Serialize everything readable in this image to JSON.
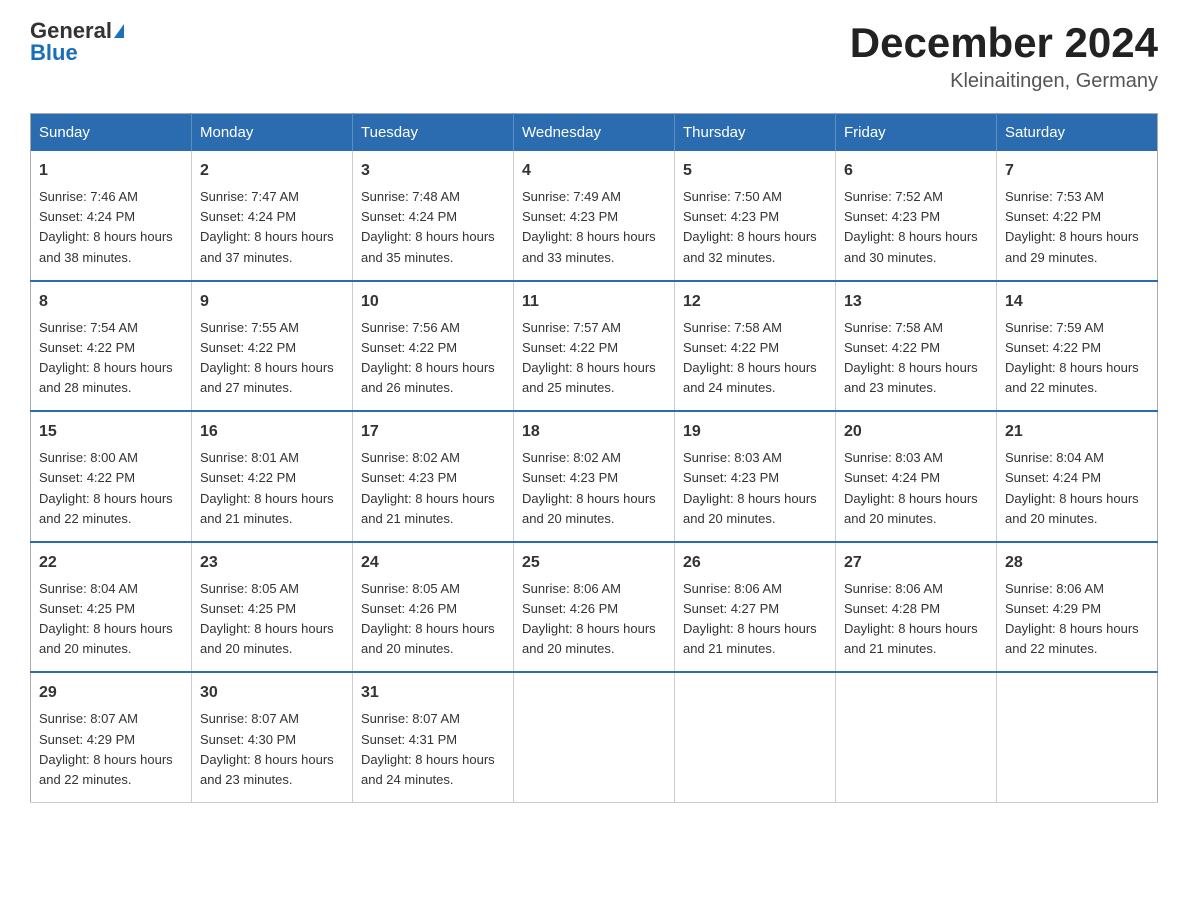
{
  "header": {
    "logo_general": "General",
    "logo_blue": "Blue",
    "month_title": "December 2024",
    "location": "Kleinaitingen, Germany"
  },
  "days_of_week": [
    "Sunday",
    "Monday",
    "Tuesday",
    "Wednesday",
    "Thursday",
    "Friday",
    "Saturday"
  ],
  "weeks": [
    [
      {
        "day": "1",
        "sunrise": "7:46 AM",
        "sunset": "4:24 PM",
        "daylight": "8 hours and 38 minutes."
      },
      {
        "day": "2",
        "sunrise": "7:47 AM",
        "sunset": "4:24 PM",
        "daylight": "8 hours and 37 minutes."
      },
      {
        "day": "3",
        "sunrise": "7:48 AM",
        "sunset": "4:24 PM",
        "daylight": "8 hours and 35 minutes."
      },
      {
        "day": "4",
        "sunrise": "7:49 AM",
        "sunset": "4:23 PM",
        "daylight": "8 hours and 33 minutes."
      },
      {
        "day": "5",
        "sunrise": "7:50 AM",
        "sunset": "4:23 PM",
        "daylight": "8 hours and 32 minutes."
      },
      {
        "day": "6",
        "sunrise": "7:52 AM",
        "sunset": "4:23 PM",
        "daylight": "8 hours and 30 minutes."
      },
      {
        "day": "7",
        "sunrise": "7:53 AM",
        "sunset": "4:22 PM",
        "daylight": "8 hours and 29 minutes."
      }
    ],
    [
      {
        "day": "8",
        "sunrise": "7:54 AM",
        "sunset": "4:22 PM",
        "daylight": "8 hours and 28 minutes."
      },
      {
        "day": "9",
        "sunrise": "7:55 AM",
        "sunset": "4:22 PM",
        "daylight": "8 hours and 27 minutes."
      },
      {
        "day": "10",
        "sunrise": "7:56 AM",
        "sunset": "4:22 PM",
        "daylight": "8 hours and 26 minutes."
      },
      {
        "day": "11",
        "sunrise": "7:57 AM",
        "sunset": "4:22 PM",
        "daylight": "8 hours and 25 minutes."
      },
      {
        "day": "12",
        "sunrise": "7:58 AM",
        "sunset": "4:22 PM",
        "daylight": "8 hours and 24 minutes."
      },
      {
        "day": "13",
        "sunrise": "7:58 AM",
        "sunset": "4:22 PM",
        "daylight": "8 hours and 23 minutes."
      },
      {
        "day": "14",
        "sunrise": "7:59 AM",
        "sunset": "4:22 PM",
        "daylight": "8 hours and 22 minutes."
      }
    ],
    [
      {
        "day": "15",
        "sunrise": "8:00 AM",
        "sunset": "4:22 PM",
        "daylight": "8 hours and 22 minutes."
      },
      {
        "day": "16",
        "sunrise": "8:01 AM",
        "sunset": "4:22 PM",
        "daylight": "8 hours and 21 minutes."
      },
      {
        "day": "17",
        "sunrise": "8:02 AM",
        "sunset": "4:23 PM",
        "daylight": "8 hours and 21 minutes."
      },
      {
        "day": "18",
        "sunrise": "8:02 AM",
        "sunset": "4:23 PM",
        "daylight": "8 hours and 20 minutes."
      },
      {
        "day": "19",
        "sunrise": "8:03 AM",
        "sunset": "4:23 PM",
        "daylight": "8 hours and 20 minutes."
      },
      {
        "day": "20",
        "sunrise": "8:03 AM",
        "sunset": "4:24 PM",
        "daylight": "8 hours and 20 minutes."
      },
      {
        "day": "21",
        "sunrise": "8:04 AM",
        "sunset": "4:24 PM",
        "daylight": "8 hours and 20 minutes."
      }
    ],
    [
      {
        "day": "22",
        "sunrise": "8:04 AM",
        "sunset": "4:25 PM",
        "daylight": "8 hours and 20 minutes."
      },
      {
        "day": "23",
        "sunrise": "8:05 AM",
        "sunset": "4:25 PM",
        "daylight": "8 hours and 20 minutes."
      },
      {
        "day": "24",
        "sunrise": "8:05 AM",
        "sunset": "4:26 PM",
        "daylight": "8 hours and 20 minutes."
      },
      {
        "day": "25",
        "sunrise": "8:06 AM",
        "sunset": "4:26 PM",
        "daylight": "8 hours and 20 minutes."
      },
      {
        "day": "26",
        "sunrise": "8:06 AM",
        "sunset": "4:27 PM",
        "daylight": "8 hours and 21 minutes."
      },
      {
        "day": "27",
        "sunrise": "8:06 AM",
        "sunset": "4:28 PM",
        "daylight": "8 hours and 21 minutes."
      },
      {
        "day": "28",
        "sunrise": "8:06 AM",
        "sunset": "4:29 PM",
        "daylight": "8 hours and 22 minutes."
      }
    ],
    [
      {
        "day": "29",
        "sunrise": "8:07 AM",
        "sunset": "4:29 PM",
        "daylight": "8 hours and 22 minutes."
      },
      {
        "day": "30",
        "sunrise": "8:07 AM",
        "sunset": "4:30 PM",
        "daylight": "8 hours and 23 minutes."
      },
      {
        "day": "31",
        "sunrise": "8:07 AM",
        "sunset": "4:31 PM",
        "daylight": "8 hours and 24 minutes."
      },
      null,
      null,
      null,
      null
    ]
  ],
  "labels": {
    "sunrise": "Sunrise:",
    "sunset": "Sunset:",
    "daylight": "Daylight:"
  }
}
